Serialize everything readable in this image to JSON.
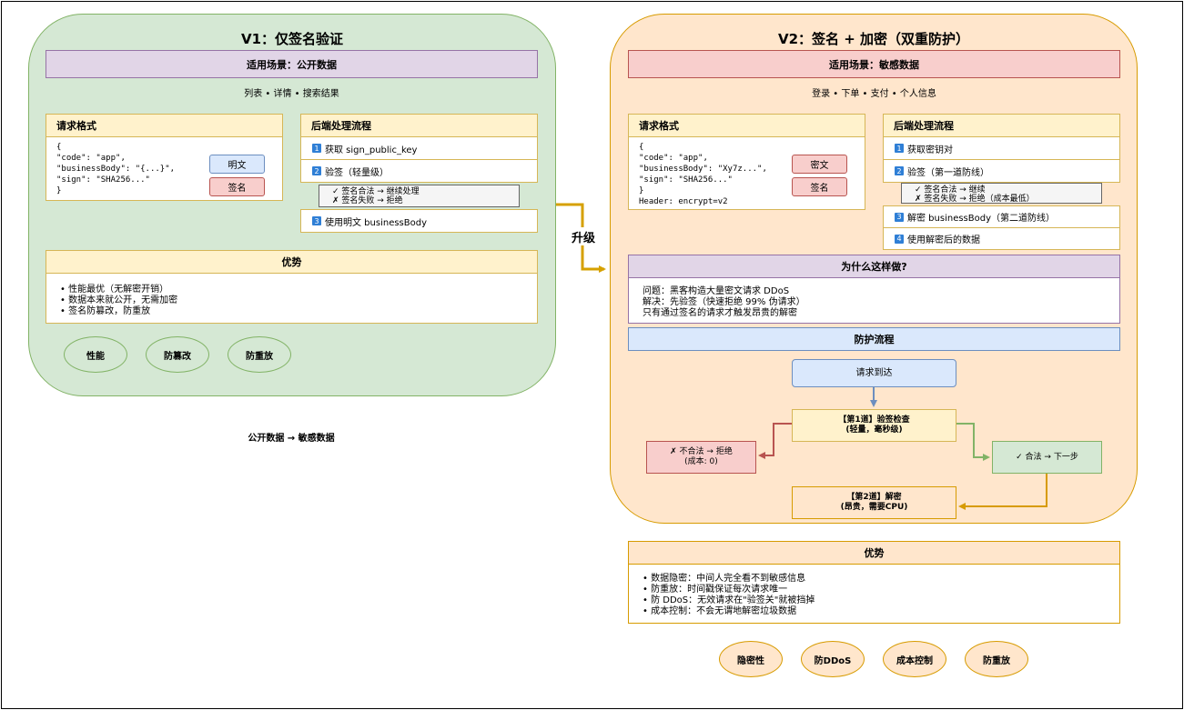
{
  "v1": {
    "title": "V1：仅签名验证",
    "scene": "适用场景：公开数据",
    "examples": "列表 • 详情 • 搜索结果",
    "request": {
      "title": "请求格式",
      "code": "{\n\"code\": \"app\",\n\"businessBody\": \"{...}\",\n\"sign\": \"SHA256...\"\n}",
      "tag_plain": "明文",
      "tag_sign": "签名"
    },
    "backend": {
      "title": "后端处理流程",
      "step1_num": "1",
      "step1": "获取 sign_public_key",
      "step2_num": "2",
      "step2": "验签（轻量级）",
      "note1": "✓ 签名合法 → 继续处理",
      "note2": "✗ 签名失败 → 拒绝",
      "step3_num": "3",
      "step3": "使用明文 businessBody"
    },
    "advantages": {
      "title": "优势",
      "items": "• 性能最优（无解密开销）\n• 数据本来就公开，无需加密\n• 签名防篡改，防重放"
    },
    "ovals": [
      "性能",
      "防篡改",
      "防重放"
    ]
  },
  "upgrade_label": "升级",
  "bottom_caption": "公开数据 → 敏感数据",
  "v2": {
    "title": "V2：签名 + 加密（双重防护）",
    "scene": "适用场景：敏感数据",
    "examples": "登录 • 下单 • 支付 • 个人信息",
    "request": {
      "title": "请求格式",
      "code": "{\n\"code\": \"app\",\n\"businessBody\": \"Xy7z...\",\n\"sign\": \"SHA256...\"\n}\nHeader: encrypt=v2",
      "tag_cipher": "密文",
      "tag_sign": "签名"
    },
    "backend": {
      "title": "后端处理流程",
      "step1_num": "1",
      "step1": "获取密钥对",
      "step2_num": "2",
      "step2": "验签（第一道防线）",
      "note1": "✓ 签名合法 → 继续",
      "note2": "✗ 签名失败 → 拒绝（成本最低）",
      "step3_num": "3",
      "step3": "解密 businessBody（第二道防线）",
      "step4_num": "4",
      "step4": "使用解密后的数据"
    },
    "why": {
      "title": "为什么这样做?",
      "text": "问题：黑客构造大量密文请求 DDoS\n解决：先验签（快速拒绝 99% 伪请求）\n只有通过签名的请求才触发昂贵的解密"
    },
    "flow": {
      "title": "防护流程",
      "arrive": "请求到达",
      "check": "【第1道】验签检查\n(轻量，毫秒级)",
      "reject": "✗ 不合法 → 拒绝\n(成本: 0)",
      "pass": "✓ 合法 → 下一步",
      "decrypt": "【第2道】解密\n(昂贵，需要CPU)"
    },
    "advantages": {
      "title": "优势",
      "items": "• 数据隐密：中间人完全看不到敏感信息\n• 防重放：时间戳保证每次请求唯一\n• 防 DDoS：无效请求在\"验签关\"就被挡掉\n• 成本控制：不会无谓地解密垃圾数据"
    },
    "ovals": [
      "隐密性",
      "防DDoS",
      "成本控制",
      "防重放"
    ]
  },
  "colors": {
    "green_fill": "#d5e8d4",
    "green_stroke": "#82b366",
    "orange_fill": "#ffe6cc",
    "orange_stroke": "#d79b00",
    "yellow_fill": "#fff2cc",
    "yellow_stroke": "#d6b656",
    "purple_fill": "#e1d5e7",
    "red_fill": "#f8cecc",
    "blue_fill": "#dae8fc",
    "upgrade_arrow": "#d6a000"
  }
}
